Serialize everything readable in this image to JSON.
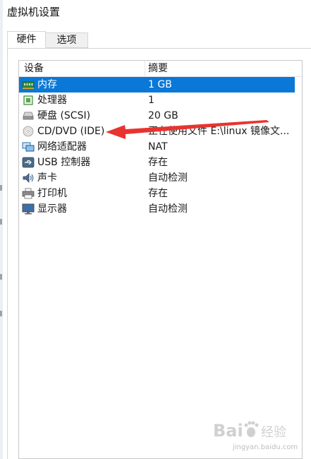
{
  "window": {
    "title": "虚拟机设置"
  },
  "tabs": [
    {
      "label": "硬件",
      "active": true
    },
    {
      "label": "选项",
      "active": false
    }
  ],
  "device_list": {
    "columns": {
      "device": "设备",
      "summary": "摘要"
    },
    "rows": [
      {
        "icon": "memory-icon",
        "device": "内存",
        "summary": "1 GB",
        "selected": true
      },
      {
        "icon": "processor-icon",
        "device": "处理器",
        "summary": "1",
        "selected": false
      },
      {
        "icon": "hard-disk-icon",
        "device": "硬盘 (SCSI)",
        "summary": "20 GB",
        "selected": false
      },
      {
        "icon": "cd-dvd-icon",
        "device": "CD/DVD (IDE)",
        "summary": "正在使用文件 E:\\linux 镜像文...",
        "selected": false
      },
      {
        "icon": "network-adapter-icon",
        "device": "网络适配器",
        "summary": "NAT",
        "selected": false
      },
      {
        "icon": "usb-controller-icon",
        "device": "USB 控制器",
        "summary": "存在",
        "selected": false
      },
      {
        "icon": "sound-card-icon",
        "device": "声卡",
        "summary": "自动检测",
        "selected": false
      },
      {
        "icon": "printer-icon",
        "device": "打印机",
        "summary": "存在",
        "selected": false
      },
      {
        "icon": "display-icon",
        "device": "显示器",
        "summary": "自动检测",
        "selected": false
      }
    ]
  },
  "colors": {
    "selection": "#0a78d7",
    "annotation_arrow": "#e8342f"
  },
  "watermark": {
    "brand": "Bai 经验",
    "url": "jingyan.baidu.com"
  }
}
